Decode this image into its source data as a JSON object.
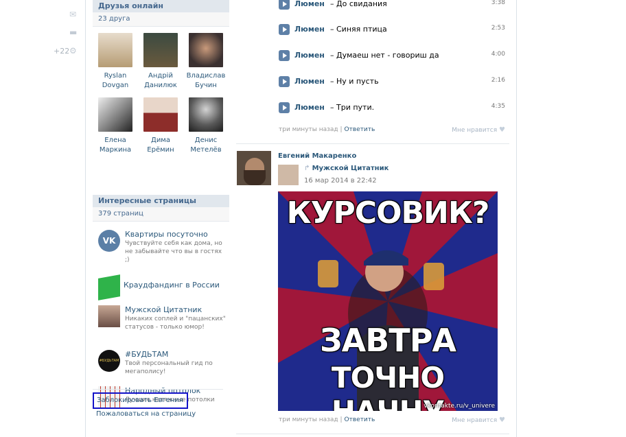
{
  "left_nav": {
    "counter": "+22"
  },
  "friends_online": {
    "title": "Друзья онлайн",
    "count": "23 друга",
    "friends": [
      {
        "first": "Ryslan",
        "last": "Dovgan"
      },
      {
        "first": "Андрій",
        "last": "Данилюк"
      },
      {
        "first": "Владислав",
        "last": "Бучин"
      },
      {
        "first": "Елена",
        "last": "Маркина"
      },
      {
        "first": "Дима",
        "last": "Ерёмин"
      },
      {
        "first": "Денис",
        "last": "Метелёв"
      }
    ]
  },
  "interesting_pages": {
    "title": "Интересные страницы",
    "count": "379 страниц",
    "pages": [
      {
        "title": "Квартиры посуточно",
        "desc": "Чувствуйте себя как дома, но не забывайте что вы в гостях ;)"
      },
      {
        "title": "Краудфандинг в России",
        "desc": ""
      },
      {
        "title": "Мужской Цитатник",
        "desc": "Никаких соплей и \"пацанских\" статусов - только юмор!"
      },
      {
        "title": "#БУДЬТАМ",
        "desc": "Твой персональный гид по мегаполису!"
      },
      {
        "title": "Народный потолок",
        "desc": "Лучшие натяжные потолки"
      }
    ]
  },
  "actions": {
    "block": "Заблокировать Евгения",
    "report": "Пожаловаться на страницу"
  },
  "tracks": [
    {
      "artist": "Люмен",
      "title": "– До свидания",
      "duration": "3:38"
    },
    {
      "artist": "Люмен",
      "title": "– Синяя птица",
      "duration": "2:53"
    },
    {
      "artist": "Люмен",
      "title": "– Думаеш нет - говориш да",
      "duration": "4:00"
    },
    {
      "artist": "Люмен",
      "title": "– Ну и пусть",
      "duration": "2:16"
    },
    {
      "artist": "Люмен",
      "title": "– Три пути.",
      "duration": "4:35"
    }
  ],
  "post1_meta": {
    "time": "три минуты назад",
    "sep": "|",
    "reply": "Ответить",
    "like": "Мне нравится"
  },
  "post2": {
    "author": "Евгений Макаренко",
    "repost_from": "Мужской Цитатник",
    "date": "16 мар 2014 в 22:42",
    "meme_top": "КУРСОВИК?",
    "meme_bottom1": "ЗАВТРА",
    "meme_bottom2": "ТОЧНО НАЧНУ",
    "watermark": "vkontakte.ru/v_univere",
    "meta": {
      "time": "три минуты назад",
      "sep": "|",
      "reply": "Ответить",
      "like": "Мне нравится"
    }
  },
  "colors": {
    "link": "#2b587a",
    "header_bg": "#e1e7ed",
    "block_border": "#1313c8",
    "play": "#5e80a7"
  }
}
